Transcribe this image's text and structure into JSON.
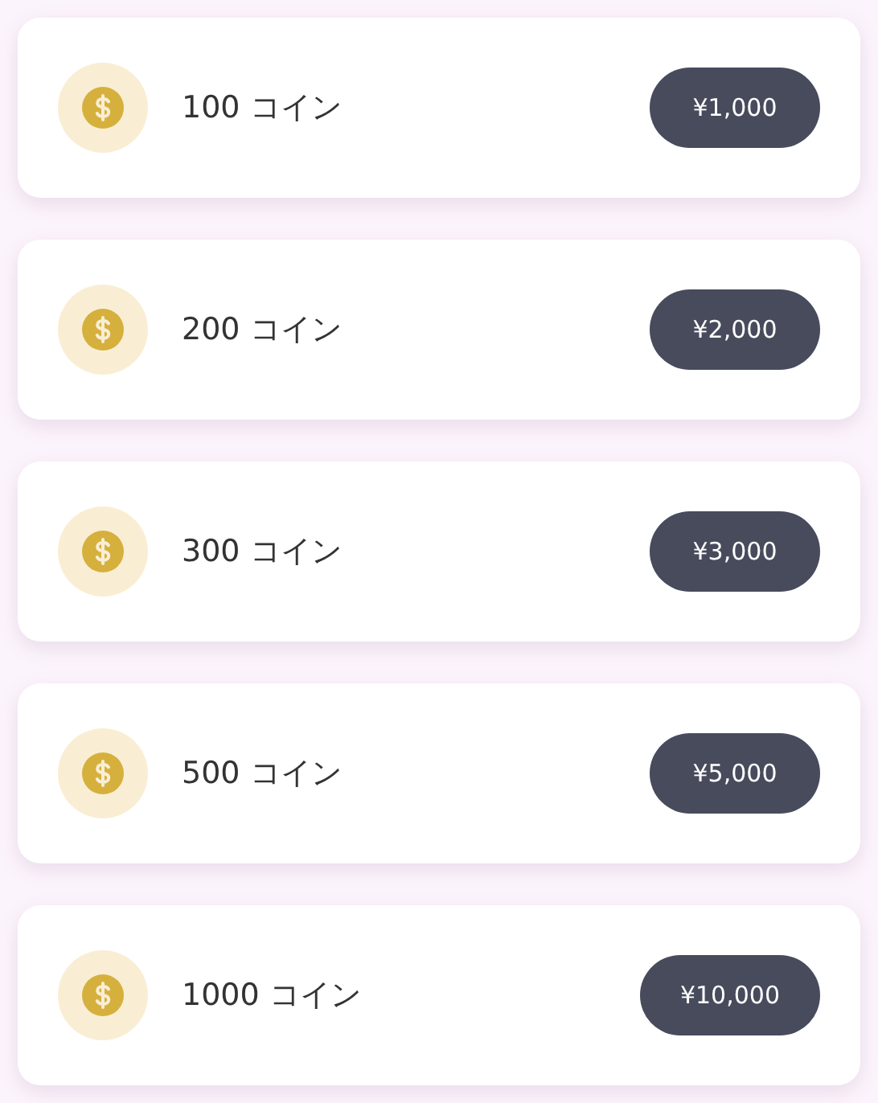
{
  "packages": [
    {
      "label": "100 コイン",
      "price": "¥1,000"
    },
    {
      "label": "200 コイン",
      "price": "¥2,000"
    },
    {
      "label": "300 コイン",
      "price": "¥3,000"
    },
    {
      "label": "500 コイン",
      "price": "¥5,000"
    },
    {
      "label": "1000 コイン",
      "price": "¥10,000"
    }
  ]
}
